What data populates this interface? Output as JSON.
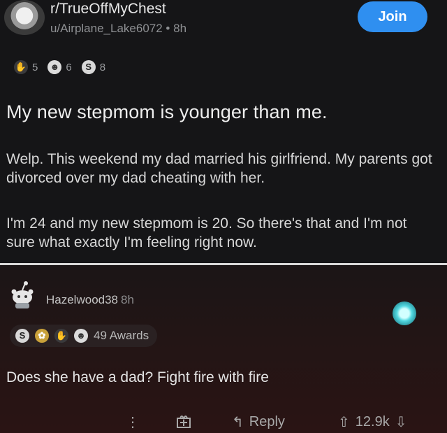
{
  "post": {
    "subreddit": "r/TrueOffMyChest",
    "author": "u/Airplane_Lake6072",
    "age": "8h",
    "join_label": "Join",
    "awards": [
      {
        "icon": "helpful-award-icon",
        "count": "5"
      },
      {
        "icon": "wholesome-award-icon",
        "count": "6"
      },
      {
        "icon": "silver-award-icon",
        "count": "8"
      }
    ],
    "title": "My new stepmom is younger than me.",
    "paragraphs": [
      "Welp. This weekend my dad married his girlfriend. My parents got divorced over my dad cheating with her.",
      "I'm 24 and my new stepmom is 20. So there's that and I'm not sure what exactly I'm feeling right now."
    ]
  },
  "comment": {
    "username": "Hazelwood38",
    "age": "8h",
    "awards_label": "49 Awards",
    "text": "Does she have a dad? Fight fire with fire",
    "reply_label": "Reply",
    "score": "12.9k"
  },
  "colors": {
    "join_button": "#2f8ff0",
    "background": "#151517",
    "comment_background": "#2a1414",
    "separator": "#d8d8d8"
  }
}
